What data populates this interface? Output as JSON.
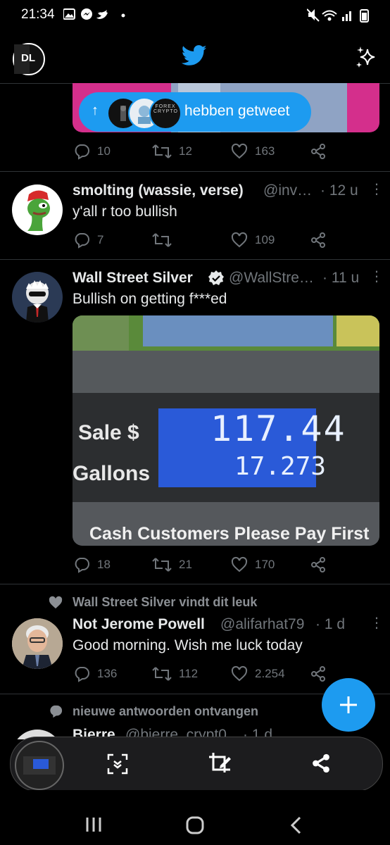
{
  "status_bar": {
    "time": "21:34"
  },
  "header": {
    "logo_text": "DL"
  },
  "banner": {
    "label": "hebben getweet",
    "brand_text": "FOREX CRYPTO"
  },
  "tweets": [
    {
      "replies": "10",
      "retweets": "12",
      "likes": "163"
    },
    {
      "name": "smolting (wassie, verse)",
      "handle": "@inv…",
      "time": "· 12 u",
      "text": "y'all r too bullish",
      "replies": "7",
      "retweets": "",
      "likes": "109"
    },
    {
      "name": "Wall Street Silver",
      "handle": "@WallStre…",
      "time": "· 11 u",
      "text": "Bullish on getting f***ed",
      "replies": "18",
      "retweets": "21",
      "likes": "170",
      "media": {
        "sale_label": "Sale $",
        "sale_value": "117.44",
        "gallons_label": "Gallons",
        "gallons_value": "17.273",
        "footer": "Cash Customers Please Pay First"
      }
    },
    {
      "context": "Wall Street Silver vindt dit leuk",
      "name": "Not Jerome Powell",
      "handle": "@alifarhat79",
      "time": "· 1 d",
      "text": "Good morning. Wish me luck today",
      "replies": "136",
      "retweets": "112",
      "likes": "2.254"
    },
    {
      "context": "nieuwe antwoorden ontvangen",
      "name": "Bjerre",
      "handle": "@bjerre_crypt0",
      "time": "· 1 d"
    }
  ],
  "icons": {
    "verified": "verified-badge-icon",
    "fab": "compose-plus-icon"
  }
}
